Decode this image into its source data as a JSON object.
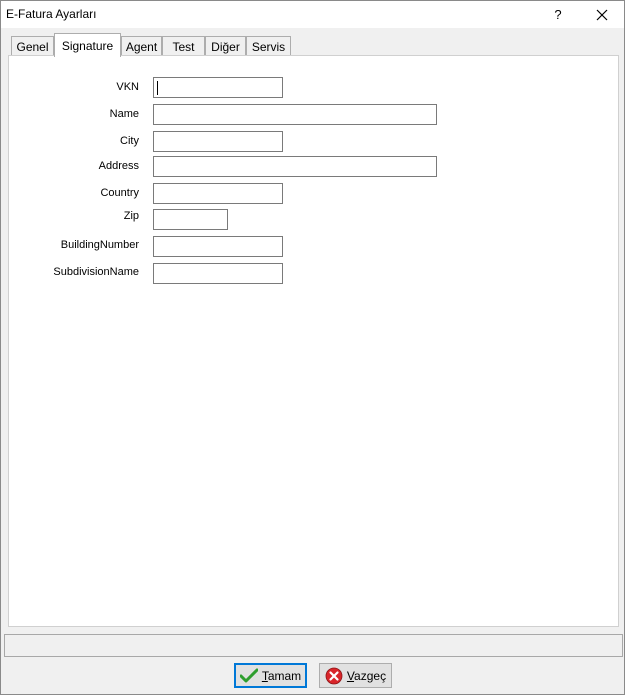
{
  "window": {
    "title": "E-Fatura Ayarları",
    "help_symbol": "?"
  },
  "tabs": [
    {
      "label": "Genel",
      "active": false
    },
    {
      "label": "Signature",
      "active": true
    },
    {
      "label": "Agent",
      "active": false
    },
    {
      "label": "Test",
      "active": false
    },
    {
      "label": "Diğer",
      "active": false
    },
    {
      "label": "Servis",
      "active": false
    }
  ],
  "form": {
    "fields": [
      {
        "label": "VKN",
        "value": ""
      },
      {
        "label": "Name",
        "value": ""
      },
      {
        "label": "City",
        "value": ""
      },
      {
        "label": "Address",
        "value": ""
      },
      {
        "label": "Country",
        "value": ""
      },
      {
        "label": "Zip",
        "value": ""
      },
      {
        "label": "BuildingNumber",
        "value": ""
      },
      {
        "label": "SubdivisionName",
        "value": ""
      }
    ]
  },
  "buttons": {
    "ok_label": "Tamam",
    "ok_mnemonic": "T",
    "ok_rest": "amam",
    "cancel_label": "Vazgeç",
    "cancel_mnemonic": "V",
    "cancel_rest": "azgeç"
  },
  "icons": {
    "ok": "check-icon",
    "cancel": "cancel-x-icon",
    "close": "close-icon"
  },
  "colors": {
    "ok_check": "#2e9e2e",
    "cancel_red": "#d9252a",
    "focus_border": "#0078d7"
  }
}
